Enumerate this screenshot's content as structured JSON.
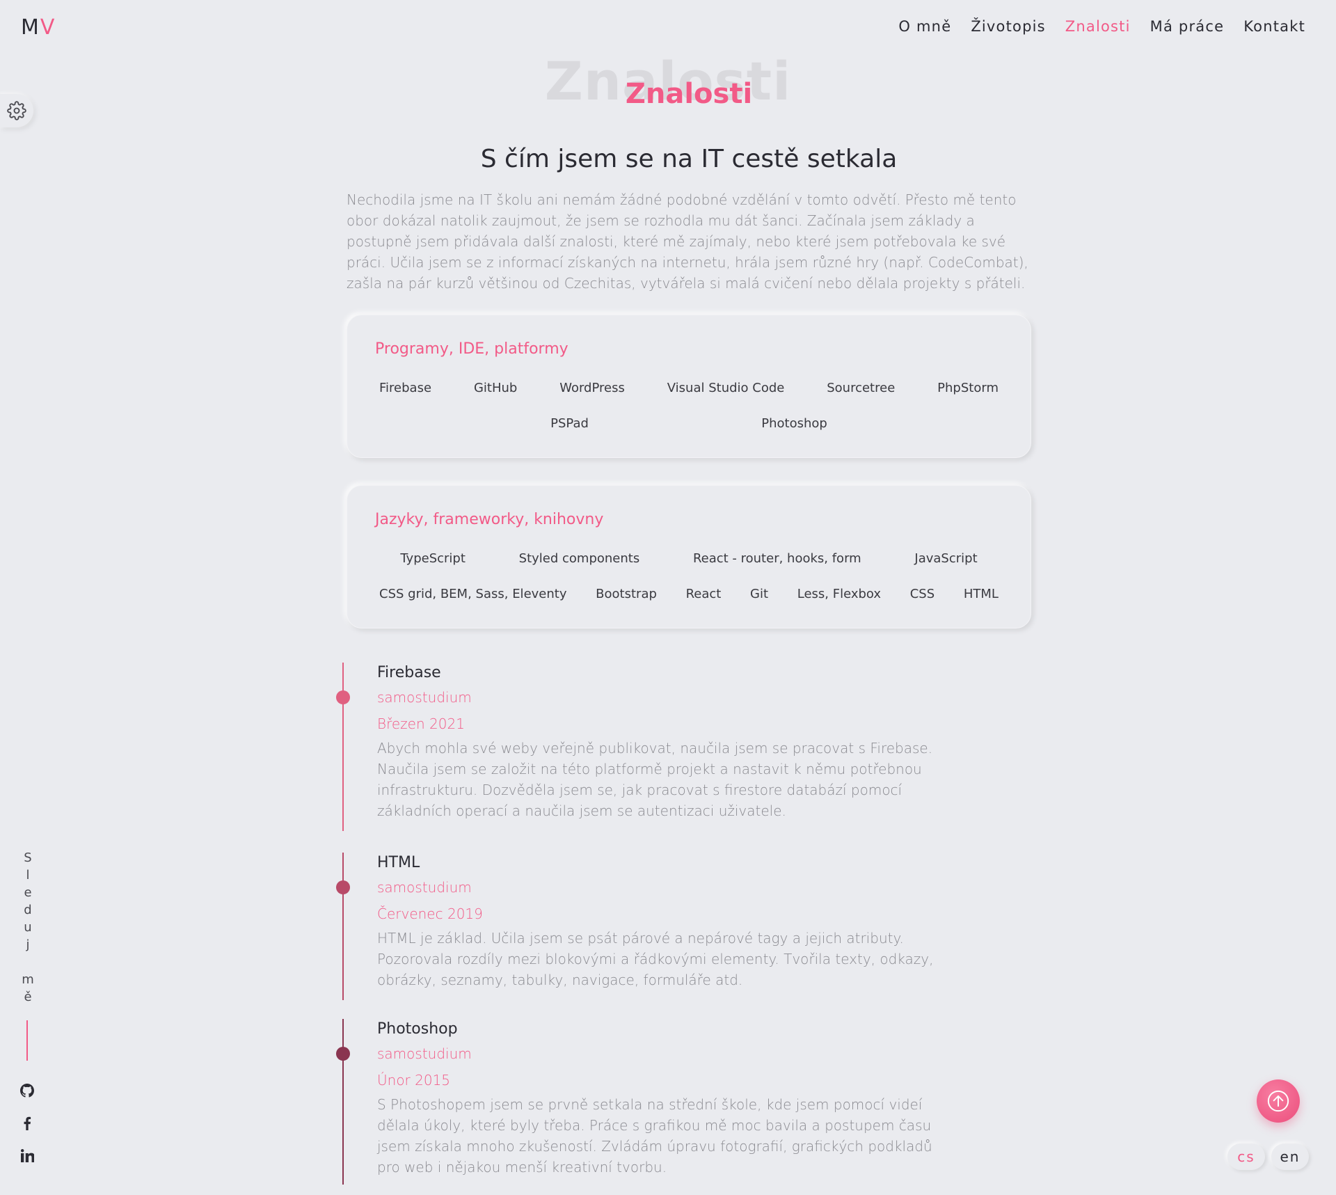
{
  "header": {
    "logo_m": "M",
    "logo_v": "V",
    "nav": [
      {
        "label": "O mně",
        "active": false
      },
      {
        "label": "Životopis",
        "active": false
      },
      {
        "label": "Znalosti",
        "active": true
      },
      {
        "label": "Má práce",
        "active": false
      },
      {
        "label": "Kontakt",
        "active": false
      }
    ]
  },
  "section": {
    "bg_title": "Znalosti",
    "title": "Znalosti",
    "subtitle": "S čím jsem se na IT cestě setkala",
    "intro": "Nechodila jsme na IT školu ani nemám žádné podobné vzdělání v tomto odvětí. Přesto mě tento obor dokázal natolik zaujmout, že jsem se rozhodla mu dát šanci. Začínala jsem základy a postupně jsem přidávala další znalosti, které mě zajímaly, nebo které jsem potřebovala ke své práci. Učila jsem se z informací získaných na internetu, hrála jsem různé hry (např. CodeCombat), zašla na pár kurzů většinou od Czechitas, vytvářela si malá cvičení nebo dělala projekty s přáteli."
  },
  "cards": [
    {
      "title": "Programy, IDE, platformy",
      "items": [
        "Firebase",
        "GitHub",
        "WordPress",
        "Visual Studio Code",
        "Sourcetree",
        "PhpStorm",
        "PSPad",
        "Photoshop"
      ]
    },
    {
      "title": "Jazyky, frameworky, knihovny",
      "items": [
        "TypeScript",
        "Styled components",
        "React - router, hooks, form",
        "JavaScript",
        "CSS grid, BEM, Sass, Eleventy",
        "Bootstrap",
        "React",
        "Git",
        "Less, Flexbox",
        "CSS",
        "HTML"
      ]
    }
  ],
  "timeline": [
    {
      "title": "Firebase",
      "type": "samostudium",
      "date": "Březen 2021",
      "desc": "Abych mohla své weby veřejně publikovat, naučila jsem se pracovat s Firebase. Naučila jsem se založit na této platformě projekt a nastavit k němu potřebnou infrastrukturu. Dozvěděla jsem se, jak pracovat s firestore databází pomocí základních operací a naučila jsem se autentizaci uživatele.",
      "color": "#e06080"
    },
    {
      "title": "HTML",
      "type": "samostudium",
      "date": "Červenec 2019",
      "desc": "HTML je základ. Učila jsem se psát párové a nepárové tagy a jejich atributy. Pozorovala rozdíly mezi blokovými a řádkovými elementy. Tvořila texty, odkazy, obrázky, seznamy, tabulky, navigace, formuláře atd.",
      "color": "#b84a68"
    },
    {
      "title": "Photoshop",
      "type": "samostudium",
      "date": "Únor 2015",
      "desc": "S Photoshopem jsem se prvně setkala na střední škole, kde jsem pomocí videí dělala úkoly, které byly třeba. Práce s grafikou mě moc bavila a postupem času jsem získala mnoho zkušeností. Zvládám úpravu fotografií, grafických podkladů pro web i nějakou menší kreativní tvorbu.",
      "color": "#8a3550"
    }
  ],
  "follow": {
    "letters": [
      "S",
      "l",
      "e",
      "d",
      "u",
      "j",
      "",
      "m",
      "ě"
    ],
    "icons": [
      "github-icon",
      "facebook-icon",
      "linkedin-icon"
    ]
  },
  "lang": {
    "cs": "cs",
    "en": "en",
    "active": "cs"
  },
  "colors": {
    "accent": "#f25a87",
    "background": "#eaebef",
    "text": "#2b2b33",
    "muted": "#8a8a90"
  }
}
